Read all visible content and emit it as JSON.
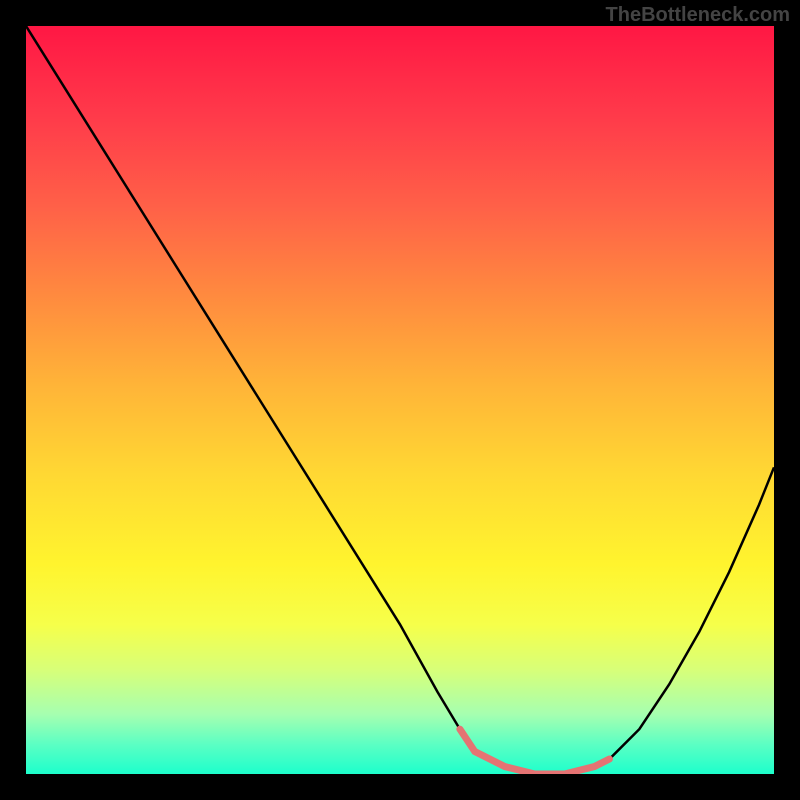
{
  "watermark": "TheBottleneck.com",
  "chart_data": {
    "type": "line",
    "title": "",
    "xlabel": "",
    "ylabel": "",
    "xlim": [
      0,
      100
    ],
    "ylim": [
      0,
      100
    ],
    "gradient_stops": [
      {
        "pct": 0,
        "color": "#ff1744"
      },
      {
        "pct": 12,
        "color": "#ff3a4a"
      },
      {
        "pct": 24,
        "color": "#ff6048"
      },
      {
        "pct": 36,
        "color": "#ff8a3f"
      },
      {
        "pct": 48,
        "color": "#ffb438"
      },
      {
        "pct": 60,
        "color": "#ffd833"
      },
      {
        "pct": 72,
        "color": "#fff42e"
      },
      {
        "pct": 80,
        "color": "#f6ff4a"
      },
      {
        "pct": 86,
        "color": "#d8ff78"
      },
      {
        "pct": 92,
        "color": "#a6ffb0"
      },
      {
        "pct": 96,
        "color": "#5cffc3"
      },
      {
        "pct": 100,
        "color": "#1dffcc"
      }
    ],
    "series": [
      {
        "name": "bottleneck-curve",
        "color": "#000000",
        "x": [
          0,
          5,
          10,
          15,
          20,
          25,
          30,
          35,
          40,
          45,
          50,
          55,
          58,
          60,
          64,
          68,
          72,
          76,
          78,
          82,
          86,
          90,
          94,
          98,
          100
        ],
        "y": [
          100,
          92,
          84,
          76,
          68,
          60,
          52,
          44,
          36,
          28,
          20,
          11,
          6,
          3,
          1,
          0,
          0,
          1,
          2,
          6,
          12,
          19,
          27,
          36,
          41
        ]
      },
      {
        "name": "highlight-segment",
        "color": "#e57373",
        "x": [
          58,
          60,
          64,
          68,
          72,
          76,
          78
        ],
        "y": [
          6,
          3,
          1,
          0,
          0,
          1,
          2
        ]
      }
    ]
  }
}
